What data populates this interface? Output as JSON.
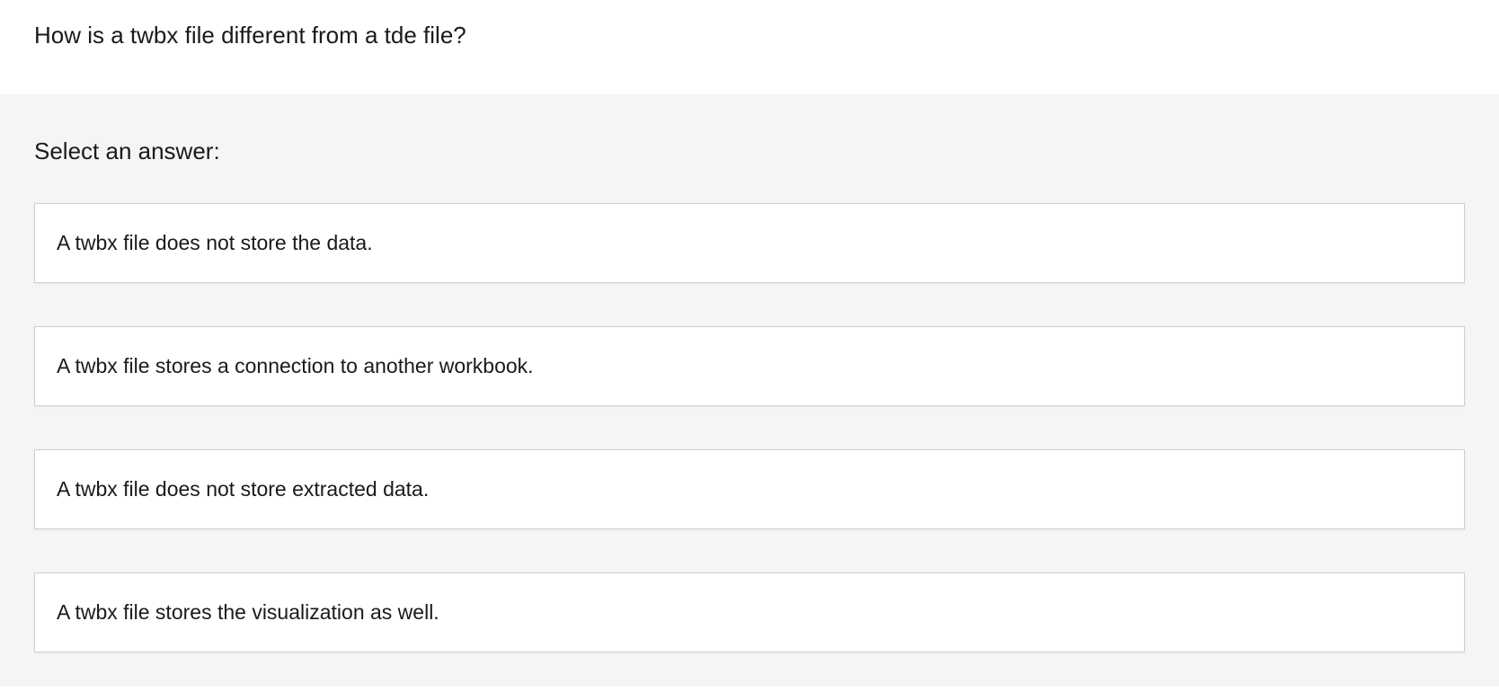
{
  "question": {
    "text": "How is a twbx file different from a tde file?"
  },
  "answers": {
    "prompt": "Select an answer:",
    "options": [
      {
        "text": "A twbx file does not store the data."
      },
      {
        "text": "A twbx file stores a connection to another workbook."
      },
      {
        "text": "A twbx file does not store extracted data."
      },
      {
        "text": "A twbx file stores the visualization as well."
      }
    ]
  }
}
